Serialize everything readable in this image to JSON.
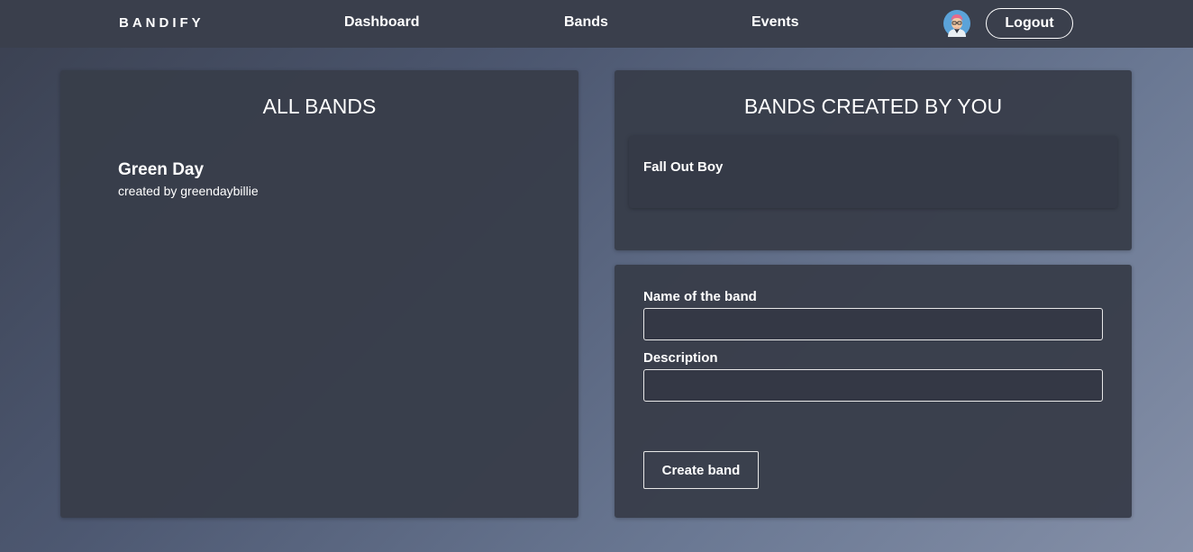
{
  "nav": {
    "brand": "BANDIFY",
    "links": [
      "Dashboard",
      "Bands",
      "Events"
    ],
    "logout_label": "Logout",
    "avatar_icon": "avatar-icon"
  },
  "all_bands": {
    "title": "ALL BANDS",
    "items": [
      {
        "name": "Green Day",
        "creator": "created by greendaybillie"
      }
    ]
  },
  "my_bands": {
    "title": "BANDS CREATED BY YOU",
    "items": [
      {
        "name": "Fall Out Boy"
      }
    ]
  },
  "create_form": {
    "name_label": "Name of the band",
    "name_value": "",
    "description_label": "Description",
    "description_value": "",
    "submit_label": "Create band"
  },
  "colors": {
    "navbar": "#3a3f4c",
    "card": "#383d4a",
    "inner_card": "#353a47"
  }
}
